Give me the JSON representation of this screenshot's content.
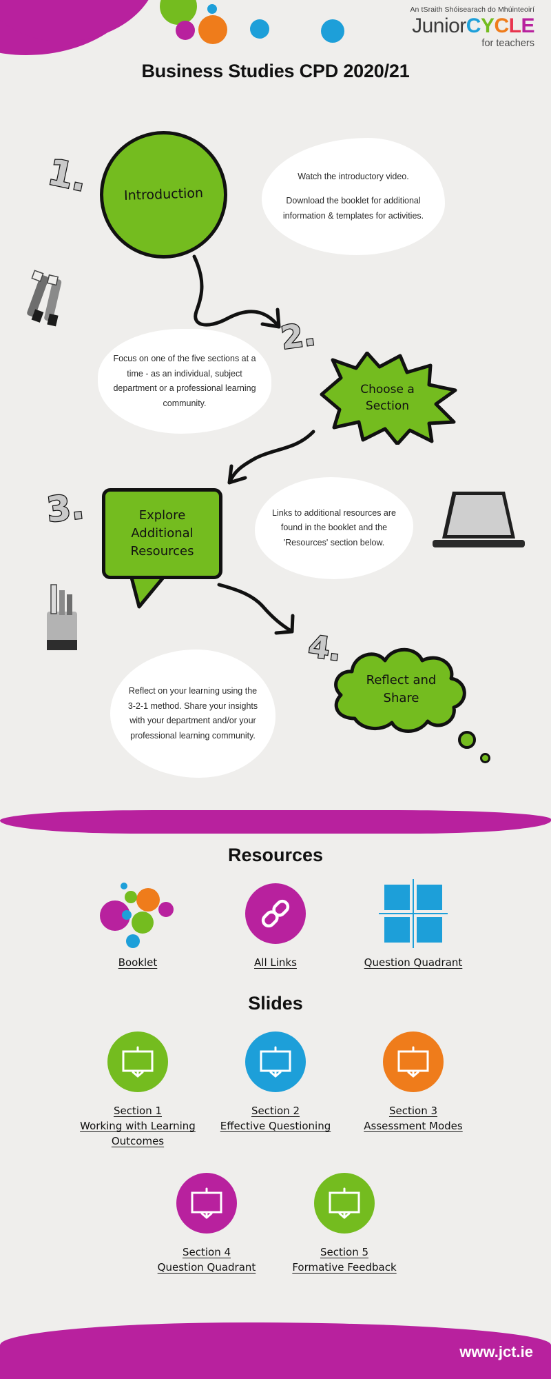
{
  "brand": {
    "tagline": "An tSraith Shóisearach do Mhúinteoirí",
    "name_part1": "Junior",
    "name_c": "C",
    "name_y": "Y",
    "name_c2": "C",
    "name_l": "L",
    "name_e": "E",
    "subtitle": "for teachers",
    "colors": {
      "magenta": "#b8219e",
      "green": "#74bc1f",
      "blue": "#1d9fd9",
      "orange": "#ef7c1b",
      "red": "#e8344e",
      "dark": "#3b3b3b"
    }
  },
  "page_title": "Business Studies CPD 2020/21",
  "flow": {
    "steps": [
      {
        "number": "1.",
        "shape_label": "Introduction",
        "note": "Watch the introductory video.\n\nDownload the booklet for additional information & templates for activities."
      },
      {
        "number": "2.",
        "shape_label": "Choose a\nSection",
        "note": "Focus on one of the five sections at a time - as an individual, subject department or a professional learning community."
      },
      {
        "number": "3.",
        "shape_label": "Explore\nAdditional\nResources",
        "note": "Links to additional resources are found in the booklet and the 'Resources' section below."
      },
      {
        "number": "4.",
        "shape_label": "Reflect and\nShare",
        "note": "Reflect on your learning using the 3-2-1 method. Share your insights with your department and/or your professional learning community."
      }
    ],
    "note_1_line1": "Watch the introductory video.",
    "note_1_line2": "Download the booklet for additional information & templates for activities.",
    "note_2": "Focus on one of the five sections at a time - as an individual, subject department or a professional learning community.",
    "note_3": "Links to additional resources are found in the booklet and the 'Resources' section below.",
    "note_4": "Reflect on your learning using the 3-2-1 method. Share your insights with your department and/or your professional learning community.",
    "label_1": "Introduction",
    "label_2_line1": "Choose a",
    "label_2_line2": "Section",
    "label_3_line1": "Explore",
    "label_3_line2": "Additional",
    "label_3_line3": "Resources",
    "label_4_line1": "Reflect and",
    "label_4_line2": "Share"
  },
  "resources": {
    "title": "Resources",
    "items": [
      {
        "label": "Booklet",
        "icon": "bubble-cluster-icon",
        "color": "#b8219e"
      },
      {
        "label": "All Links",
        "icon": "link-chain-icon",
        "color": "#b8219e"
      },
      {
        "label": "Question Quadrant",
        "icon": "quadrant-grid-icon",
        "color": "#1d9fd9"
      }
    ]
  },
  "slides": {
    "title": "Slides",
    "items": [
      {
        "section": "Section 1",
        "name_line1": "Working with Learning",
        "name_line2": "Outcomes",
        "color": "#74bc1f",
        "icon": "projector-screen-icon"
      },
      {
        "section": "Section 2",
        "name_line1": "Effective Questioning",
        "name_line2": "",
        "color": "#1d9fd9",
        "icon": "projector-screen-icon"
      },
      {
        "section": "Section 3",
        "name_line1": "Assessment Modes",
        "name_line2": "",
        "color": "#ef7c1b",
        "icon": "projector-screen-icon"
      },
      {
        "section": "Section 4",
        "name_line1": "Question Quadrant",
        "name_line2": "",
        "color": "#b8219e",
        "icon": "projector-screen-icon"
      },
      {
        "section": "Section 5",
        "name_line1": "Formative Feedback",
        "name_line2": "",
        "color": "#74bc1f",
        "icon": "projector-screen-icon"
      }
    ]
  },
  "footer": {
    "url": "www.jct.ie"
  }
}
